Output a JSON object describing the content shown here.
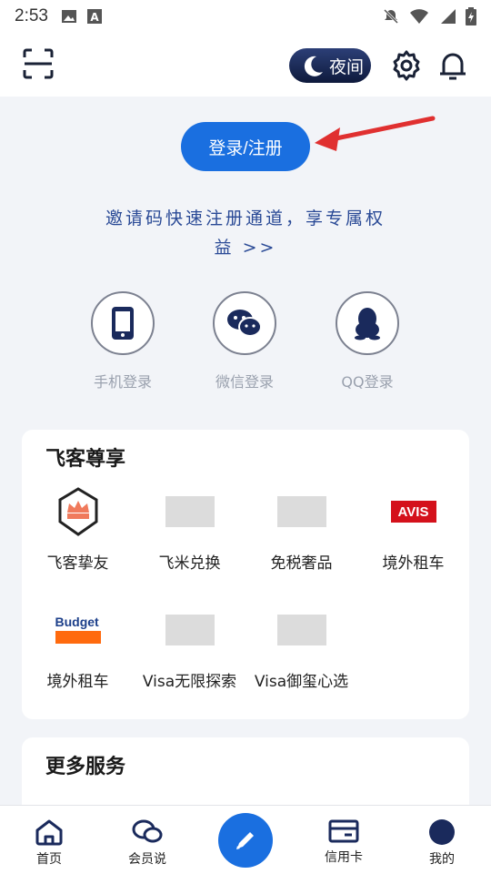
{
  "status": {
    "time": "2:53"
  },
  "header": {
    "night_label": "夜间"
  },
  "login": {
    "button_label": "登录/注册",
    "invite_line1": "邀请码快速注册通道，享专属权",
    "invite_line2": "益 >>"
  },
  "login_methods": [
    {
      "label": "手机登录"
    },
    {
      "label": "微信登录"
    },
    {
      "label": "QQ登录"
    }
  ],
  "vip": {
    "title": "飞客尊享",
    "items": [
      {
        "label": "飞客挚友"
      },
      {
        "label": "飞米兑换"
      },
      {
        "label": "免税奢品"
      },
      {
        "label": "境外租车",
        "logo": "AVIS"
      },
      {
        "label": "境外租车",
        "logo": "Budget"
      },
      {
        "label": "Visa无限探索"
      },
      {
        "label": "Visa御玺心选"
      }
    ]
  },
  "more": {
    "title": "更多服务"
  },
  "nav": [
    {
      "label": "首页"
    },
    {
      "label": "会员说"
    },
    {
      "label": "信用卡"
    },
    {
      "label": "我的"
    }
  ],
  "colors": {
    "accent": "#1a6fe0",
    "link": "#2a4a96",
    "arrow": "#e03030"
  }
}
